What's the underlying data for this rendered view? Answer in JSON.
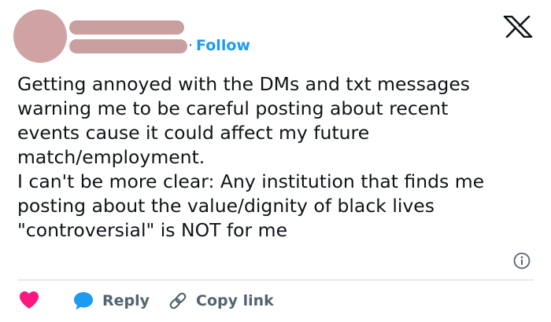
{
  "header": {
    "follow_separator": "·",
    "follow_label": "Follow"
  },
  "tweet": {
    "lines": [
      "Getting annoyed with the DMs and txt messages",
      "warning me to be careful posting about recent",
      "events cause it could affect my future",
      "match/employment.",
      "I can't be more clear: Any institution that finds me",
      "posting about the value/dignity of black lives",
      "\"controversial\" is NOT for me"
    ]
  },
  "actions": {
    "reply_label": "Reply",
    "copy_link_label": "Copy link"
  },
  "icons": {
    "logo": "x-logo-icon",
    "info": "info-icon",
    "like": "heart-icon",
    "reply": "speech-bubble-icon",
    "copy": "link-icon"
  },
  "colors": {
    "accent": "#1d9bf0",
    "heart": "#f91880",
    "muted": "#536471",
    "text": "#0f1419",
    "redacted": "#c9a0a0"
  }
}
